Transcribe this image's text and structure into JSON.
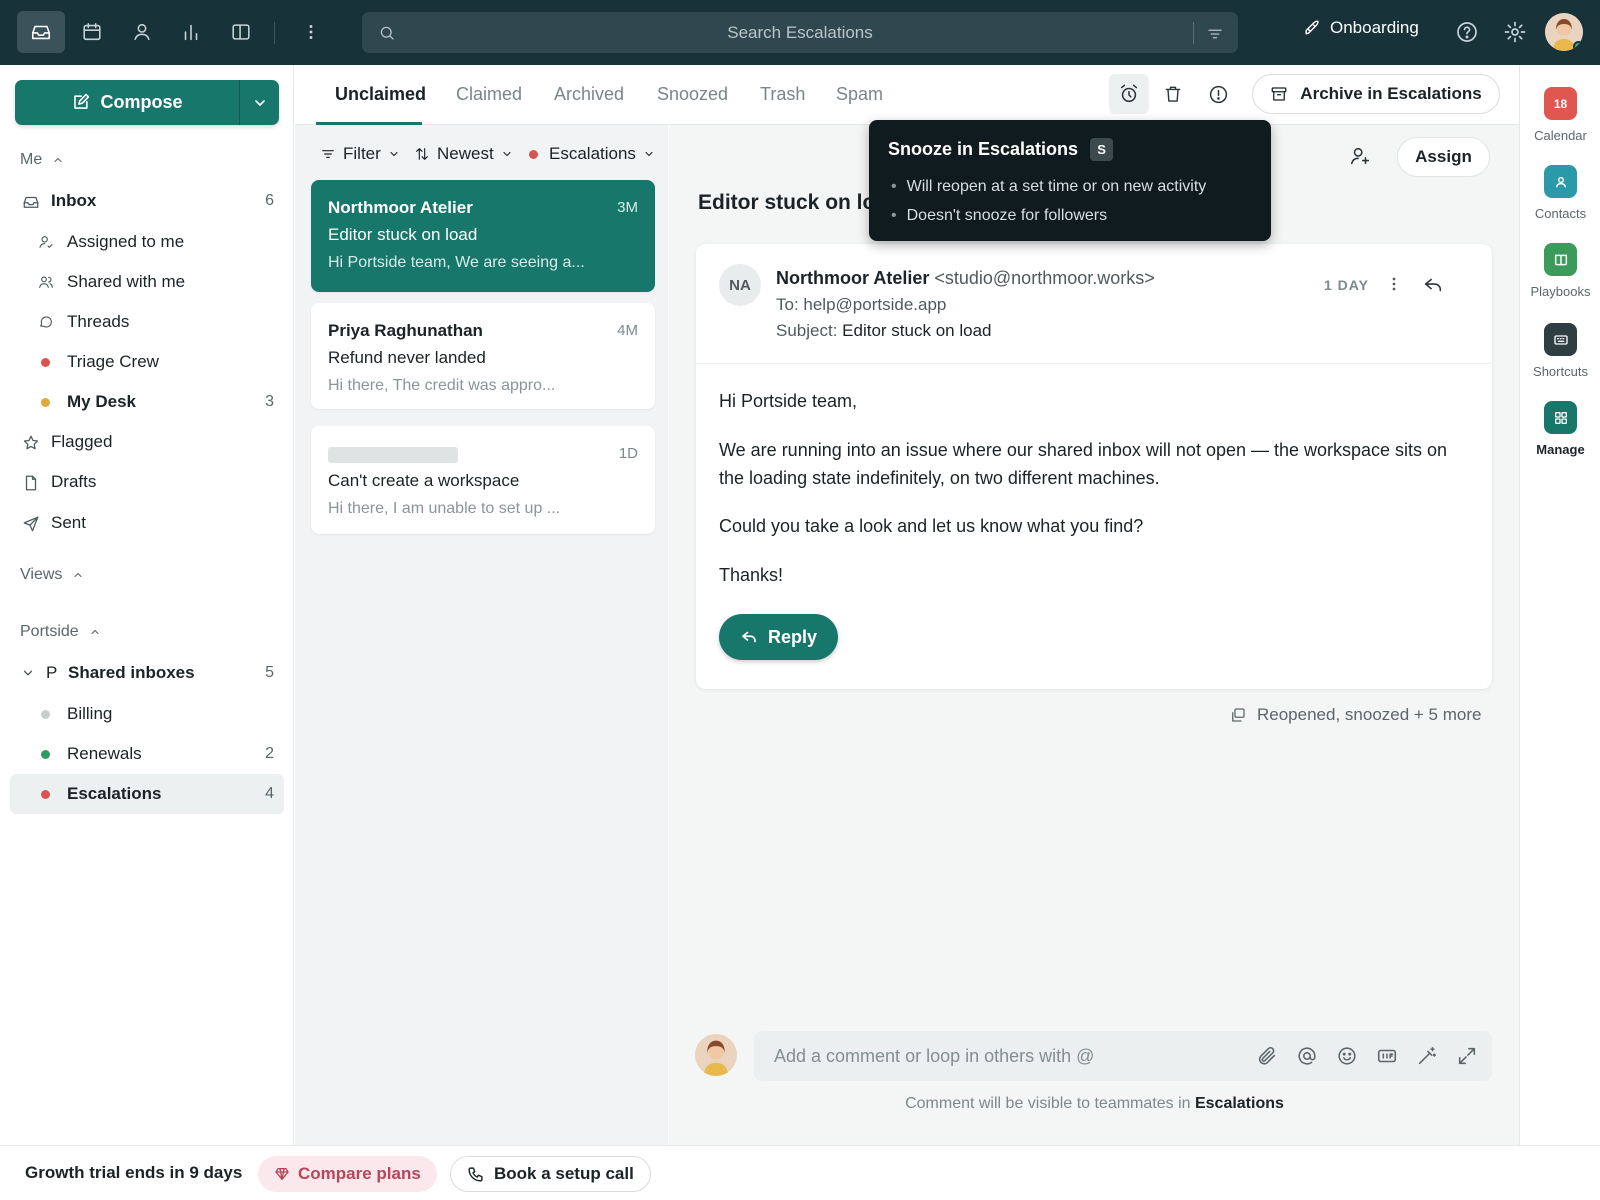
{
  "topbar": {
    "search_placeholder": "Search Escalations",
    "onboarding_label": "Onboarding"
  },
  "compose": {
    "label": "Compose"
  },
  "sidebar": {
    "me_header": "Me",
    "items": [
      {
        "label": "Inbox",
        "count": "6"
      },
      {
        "label": "Assigned to me"
      },
      {
        "label": "Shared with me"
      },
      {
        "label": "Threads"
      },
      {
        "label": "Triage Crew"
      },
      {
        "label": "My Desk",
        "count": "3"
      },
      {
        "label": "Flagged"
      },
      {
        "label": "Drafts"
      },
      {
        "label": "Sent"
      }
    ],
    "views_header": "Views",
    "portside_header": "Portside",
    "shared_inboxes": {
      "prefix": "P",
      "label": "Shared inboxes",
      "count": "5"
    },
    "inboxes": [
      {
        "label": "Billing",
        "count": ""
      },
      {
        "label": "Renewals",
        "count": "2"
      },
      {
        "label": "Escalations",
        "count": "4"
      }
    ]
  },
  "tabs": [
    "Unclaimed",
    "Claimed",
    "Archived",
    "Snoozed",
    "Trash",
    "Spam"
  ],
  "archive_label": "Archive in Escalations",
  "filters": {
    "filter": "Filter",
    "sort": "Newest",
    "inbox": "Escalations"
  },
  "conversations": [
    {
      "from": "Northmoor Atelier",
      "time": "3M",
      "subject": "Editor stuck on load",
      "preview": "Hi Portside team, We are seeing a..."
    },
    {
      "from": "Priya Raghunathan",
      "time": "4M",
      "subject": "Refund never landed",
      "preview": "Hi there, The credit was appro..."
    },
    {
      "from": "",
      "time": "1D",
      "subject": "Can't create a workspace",
      "preview": "Hi there, I am unable to set up ..."
    }
  ],
  "detail": {
    "title": "Editor stuck on lo",
    "assign_label": "Assign",
    "sender_initials": "NA",
    "sender_name": "Northmoor Atelier",
    "sender_email": "<studio@northmoor.works>",
    "to_line": "To: help@portside.app",
    "subject_prefix": "Subject:",
    "subject": "Editor stuck on load",
    "age": "1 DAY",
    "body": [
      "Hi Portside team,",
      "We are running into an issue where our shared inbox will not open — the workspace sits on the loading state indefinitely, on two different machines.",
      "Could you take a look and let us know what you find?",
      "Thanks!"
    ],
    "reply_label": "Reply",
    "activity": "Reopened, snoozed + 5 more",
    "comment_placeholder": "Add a comment or loop in others with @",
    "comment_note_prefix": "Comment will be visible to teammates in",
    "comment_note_inbox": "Escalations"
  },
  "tooltip": {
    "title": "Snooze in Escalations",
    "shortcut": "S",
    "bullets": [
      "Will reopen at a set time or on new activity",
      "Doesn't snooze for followers"
    ]
  },
  "rail": [
    {
      "label": "Calendar",
      "badge": "18"
    },
    {
      "label": "Contacts"
    },
    {
      "label": "Playbooks"
    },
    {
      "label": "Shortcuts"
    },
    {
      "label": "Manage"
    }
  ],
  "bottom": {
    "trial": "Growth trial ends in 9 days",
    "compare": "Compare plans",
    "setup": "Book a setup call"
  },
  "colors": {
    "brand": "#18776b",
    "topbar": "#173239",
    "red_dot": "#d9534f",
    "amber_dot": "#e0a93a",
    "green_dot": "#2e9b62",
    "gray_dot": "#c8cdce"
  }
}
